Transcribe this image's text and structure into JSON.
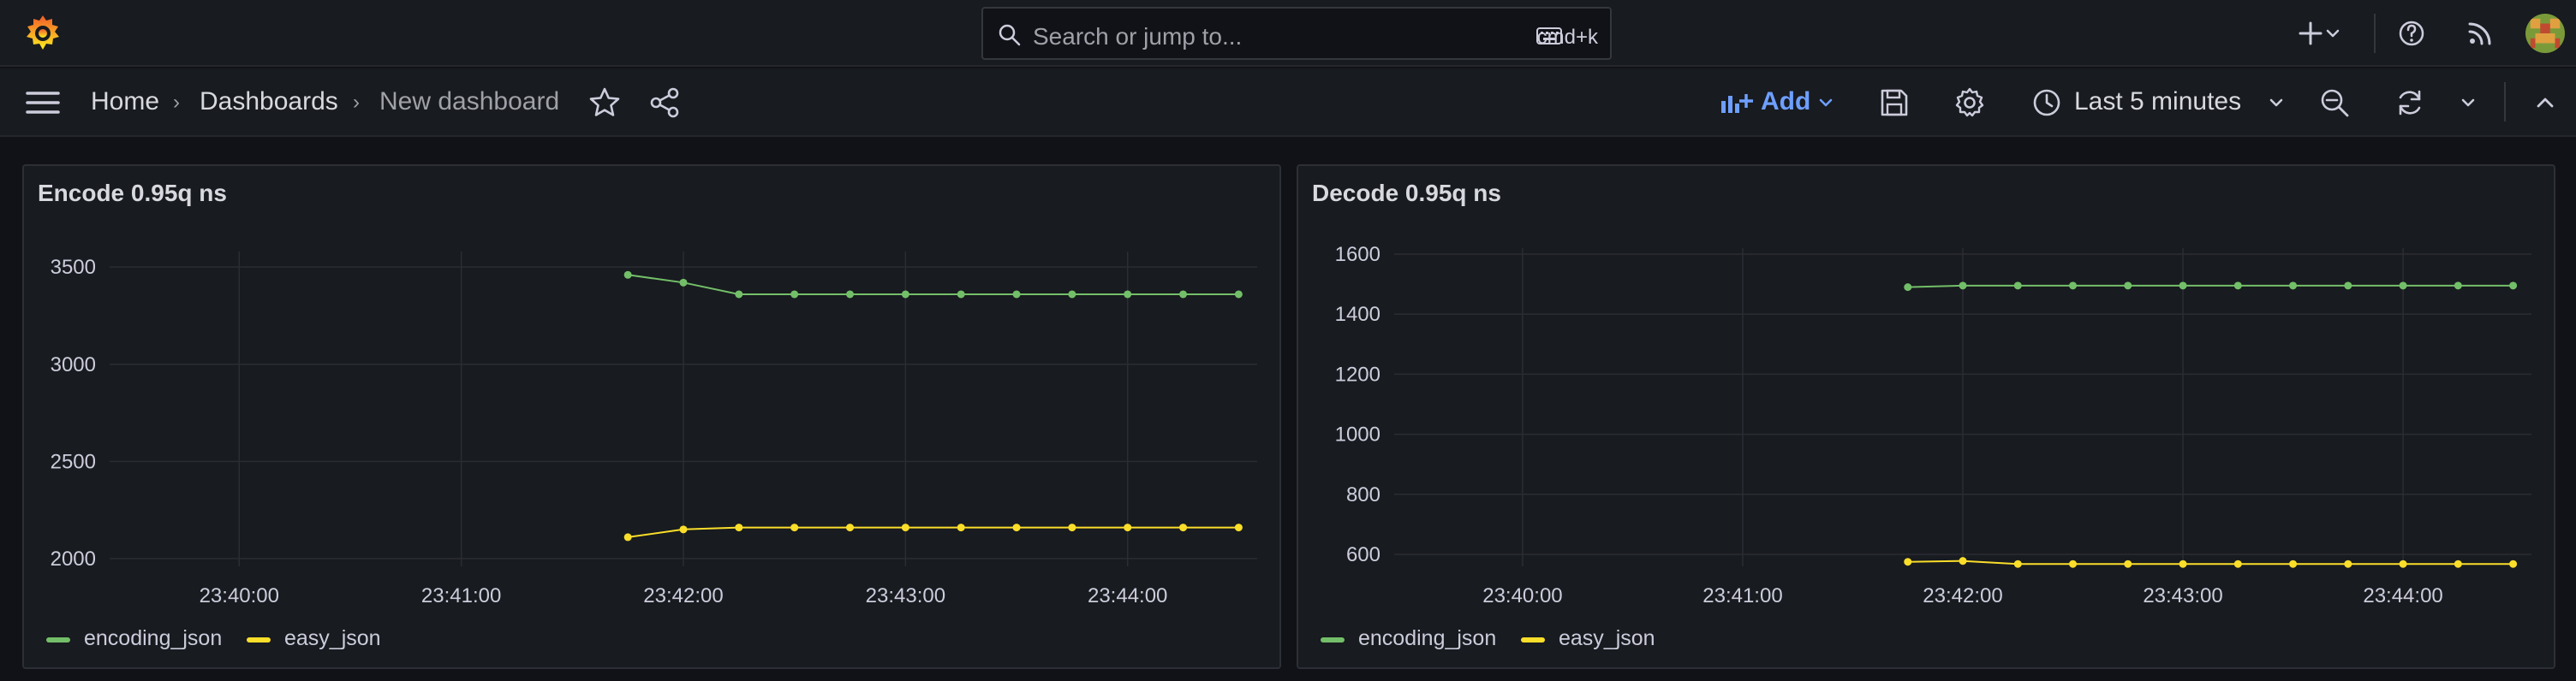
{
  "topbar": {
    "search_placeholder": "Search or jump to...",
    "shortcut": "cmd+k",
    "icons": [
      "grafana-logo-icon",
      "search-icon",
      "keyboard-icon",
      "plus-icon",
      "chevron-down-icon",
      "help-icon",
      "rss-icon",
      "avatar"
    ]
  },
  "nav": {
    "breadcrumbs": [
      "Home",
      "Dashboards",
      "New dashboard"
    ],
    "add_label": "Add",
    "time_range": "Last 5 minutes",
    "icons": [
      "menu-icon",
      "star-icon",
      "share-icon",
      "add-panel-icon",
      "save-icon",
      "settings-icon",
      "clock-icon",
      "zoom-out-icon",
      "refresh-icon",
      "collapse-icon"
    ]
  },
  "colors": {
    "encoding_json": "#73bf69",
    "easy_json": "#fade2a",
    "accent": "#6e9fff"
  },
  "chart_data": [
    {
      "type": "line",
      "title": "Encode 0.95q ns",
      "xticks": [
        "23:40:00",
        "23:41:00",
        "23:42:00",
        "23:43:00",
        "23:44:00"
      ],
      "yticks": [
        2000,
        2500,
        3000,
        3500
      ],
      "ylim": [
        1960,
        3580
      ],
      "x": [
        "23:41:45",
        "23:42:00",
        "23:42:15",
        "23:42:30",
        "23:42:45",
        "23:43:00",
        "23:43:15",
        "23:43:30",
        "23:43:45",
        "23:44:00",
        "23:44:15",
        "23:44:30"
      ],
      "xlim": [
        "23:39:25",
        "23:44:35"
      ],
      "series": [
        {
          "name": "encoding_json",
          "values": [
            3460,
            3420,
            3360,
            3360,
            3360,
            3360,
            3360,
            3360,
            3360,
            3360,
            3360,
            3360
          ]
        },
        {
          "name": "easy_json",
          "values": [
            2110,
            2150,
            2160,
            2160,
            2160,
            2160,
            2160,
            2160,
            2160,
            2160,
            2160,
            2160
          ]
        }
      ],
      "grid": true,
      "legend": "bottom-left"
    },
    {
      "type": "line",
      "title": "Decode 0.95q ns",
      "xticks": [
        "23:40:00",
        "23:41:00",
        "23:42:00",
        "23:43:00",
        "23:44:00"
      ],
      "yticks": [
        600,
        800,
        1000,
        1200,
        1400,
        1600
      ],
      "ylim": [
        560,
        1620
      ],
      "x": [
        "23:41:45",
        "23:42:00",
        "23:42:15",
        "23:42:30",
        "23:42:45",
        "23:43:00",
        "23:43:15",
        "23:43:30",
        "23:43:45",
        "23:44:00",
        "23:44:15",
        "23:44:30"
      ],
      "xlim": [
        "23:39:25",
        "23:44:35"
      ],
      "series": [
        {
          "name": "encoding_json",
          "values": [
            1490,
            1495,
            1495,
            1495,
            1495,
            1495,
            1495,
            1495,
            1495,
            1495,
            1495,
            1495
          ]
        },
        {
          "name": "easy_json",
          "values": [
            575,
            578,
            568,
            568,
            568,
            568,
            568,
            568,
            568,
            568,
            568,
            568
          ]
        }
      ],
      "grid": true,
      "legend": "bottom-left"
    }
  ]
}
